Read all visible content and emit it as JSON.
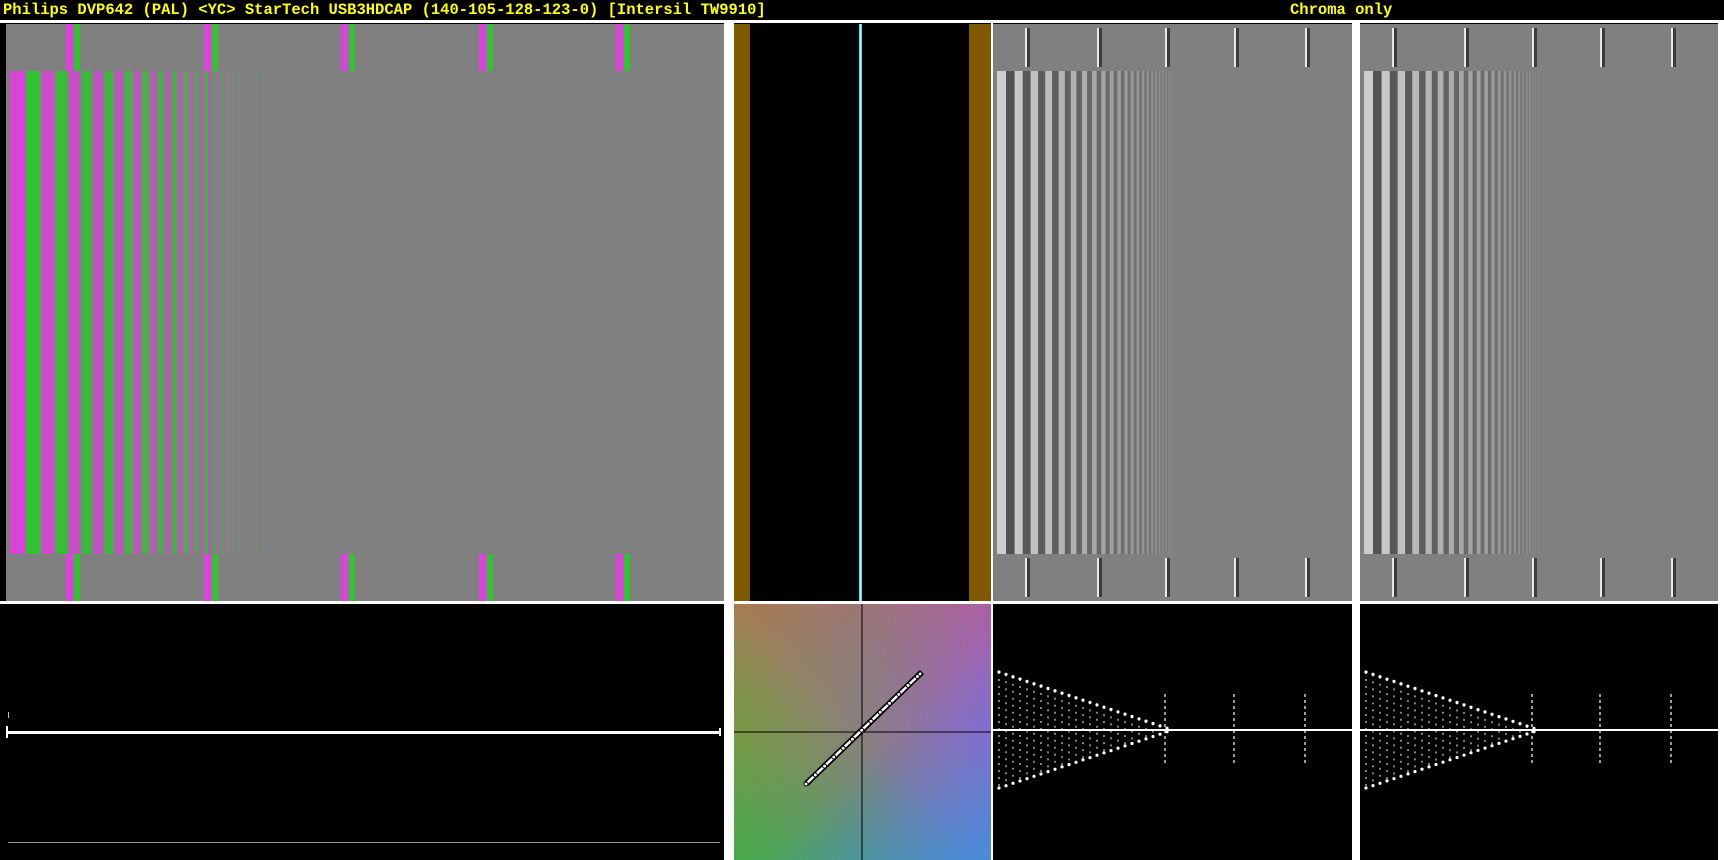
{
  "header": {
    "title": "Philips DVP642 (PAL) <YC> StarTech USB3HDCAP (140-105-128-123-0) [Intersil TW9910]",
    "mode": "Chroma only"
  },
  "colors": {
    "title_text": "#ffff00",
    "background": "#000000",
    "gray_field": "#808080",
    "magenta": "#d845d8",
    "green": "#2ec62e",
    "amber": "#7f5a00",
    "cyan_line": "#40e0f0",
    "trace": "#ffffff"
  },
  "panels": [
    {
      "name": "chroma-bars",
      "kind": "colour frequency sweep"
    },
    {
      "name": "vector-bars",
      "kind": "chroma phase display"
    },
    {
      "name": "luma-sweep-a",
      "kind": "gray frequency sweep"
    },
    {
      "name": "luma-sweep-b",
      "kind": "gray frequency sweep"
    },
    {
      "name": "waveform-left",
      "kind": "waveform"
    },
    {
      "name": "vectorscope",
      "kind": "vectorscope"
    },
    {
      "name": "waveform-a",
      "kind": "waveform"
    },
    {
      "name": "waveform-b",
      "kind": "waveform"
    }
  ]
}
